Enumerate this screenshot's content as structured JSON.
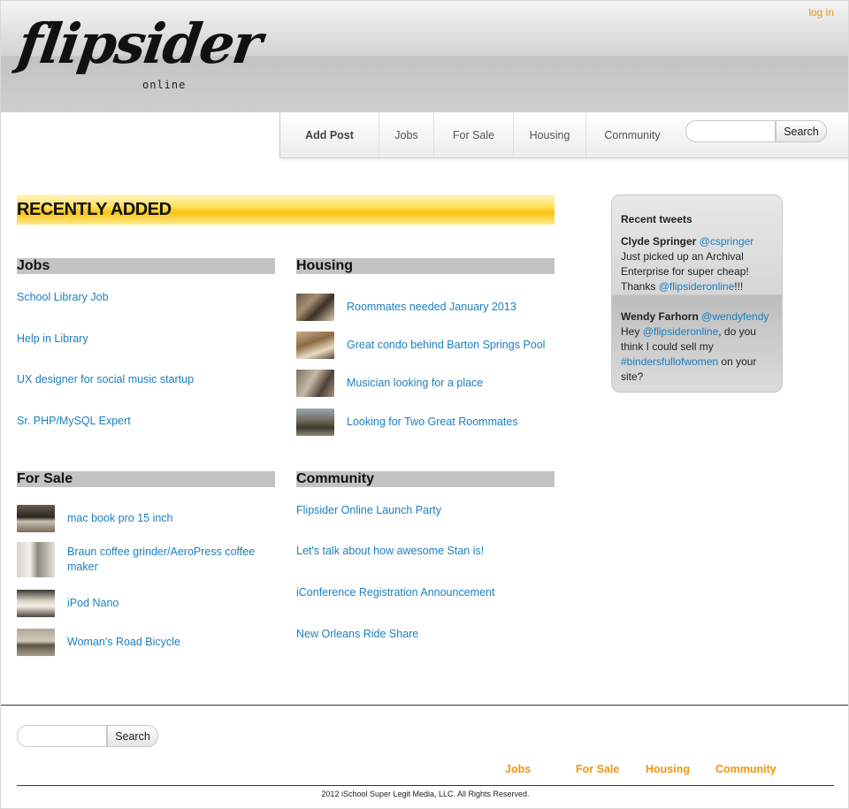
{
  "header": {
    "login_label": "log in",
    "logo_text": "flipsider",
    "logo_subtext": "online"
  },
  "nav": {
    "items": [
      "Add Post",
      "Jobs",
      "For Sale",
      "Housing",
      "Community"
    ],
    "search_placeholder": "",
    "search_button": "Search"
  },
  "recent": {
    "title": "RECENTLY ADDED"
  },
  "jobs": {
    "heading": "Jobs",
    "items": [
      "School Library Job",
      "Help in Library",
      "UX designer for social music startup",
      "Sr. PHP/MySQL Expert"
    ]
  },
  "housing": {
    "heading": "Housing",
    "items": [
      "Roommates needed January 2013",
      "Great condo behind Barton Springs Pool",
      "Musician looking for a place",
      "Looking for Two Great Roommates"
    ]
  },
  "for_sale": {
    "heading": "For Sale",
    "items": [
      "mac book pro 15 inch",
      "Braun coffee grinder/AeroPress coffee maker",
      "iPod Nano",
      "Woman's Road Bicycle"
    ]
  },
  "community": {
    "heading": "Community",
    "items": [
      "Flipsider Online Launch Party",
      "Let's talk about how awesome Stan is!",
      "iConference Registration Announcement",
      "New Orleans Ride Share"
    ]
  },
  "tweets": {
    "title": "Recent tweets",
    "list": [
      {
        "name": "Clyde Springer",
        "handle": "@cspringer",
        "text_before": "Just picked up an Archival Enterprise for super cheap! Thanks ",
        "mention": "@flipsideronline",
        "text_after": "!!!"
      },
      {
        "name": "Wendy Farhorn",
        "handle": "@wendyfendy",
        "text_before": "Hey ",
        "mention": "@flipsideronline",
        "text_mid": ", do you think I could sell my ",
        "hashtag": "#bindersfullofwomen",
        "text_after": " on your site?"
      }
    ]
  },
  "footer": {
    "search_button": "Search",
    "links": [
      "Jobs",
      "For Sale",
      "Housing",
      "Community"
    ],
    "copyright": "2012 iSchool Super Legit Media, LLC. All Rights Reserved."
  },
  "colors": {
    "link": "#1a7fc1",
    "accent_orange": "#f2950f",
    "banner_yellow": "#ffd52e",
    "section_gray": "#c3c3c3"
  }
}
